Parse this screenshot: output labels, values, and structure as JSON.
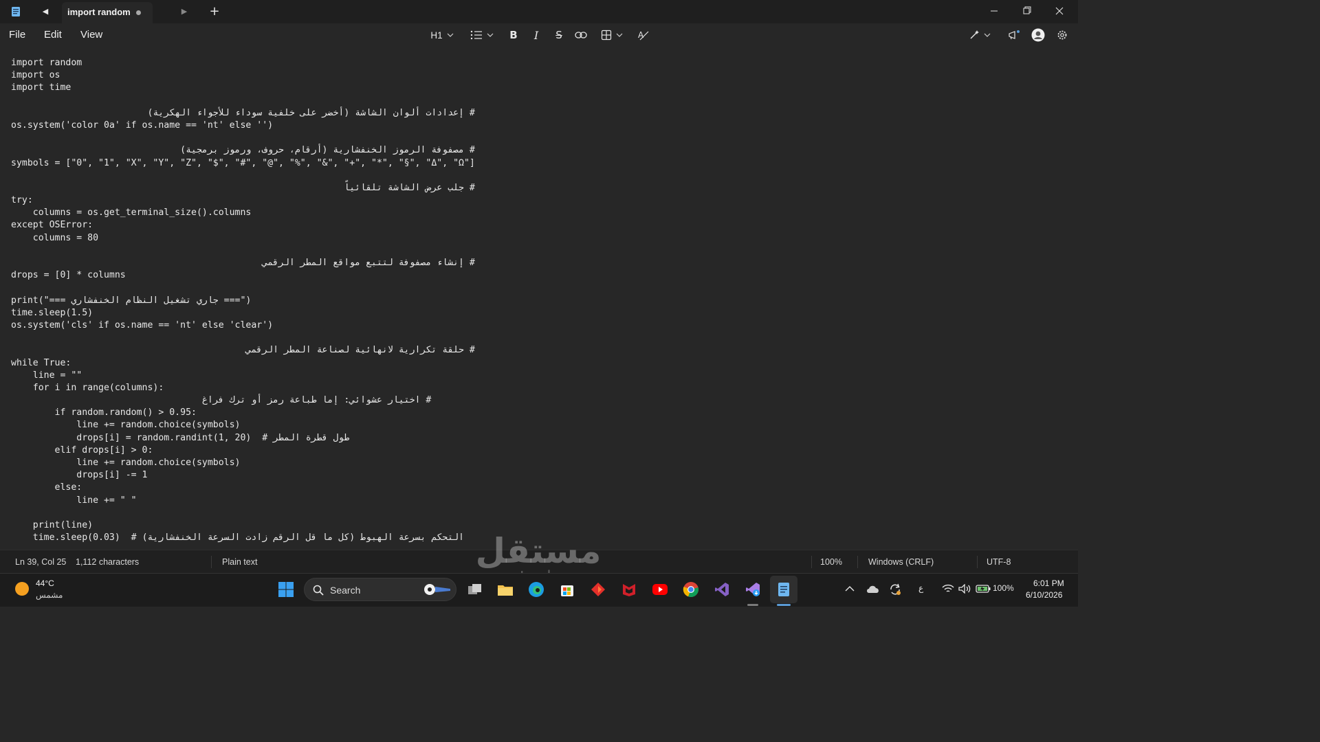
{
  "tab": {
    "title": "import random"
  },
  "menu": {
    "file": "File",
    "edit": "Edit",
    "view": "View"
  },
  "toolbar": {
    "heading": "H1"
  },
  "code_lines": [
    "import random",
    "import os",
    "import time",
    "",
    "# إعدادات ألوان الشاشة (أخضر على خلفية سوداء للأجواء الهكرية)",
    "os.system('color 0a' if os.name == 'nt' else '')",
    "",
    "# مصفوفة الرموز الخنفشارية (أرقام، حروف، ورموز برمجية)",
    "symbols = [\"0\", \"1\", \"X\", \"Y\", \"Z\", \"$\", \"#\", \"@\", \"%\", \"&\", \"+\", \"*\", \"§\", \"Δ\", \"Ω\"]",
    "",
    "# جلب عرض الشاشة تلقائياً",
    "try:",
    "    columns = os.get_terminal_size().columns",
    "except OSError:",
    "    columns = 80",
    "",
    "# إنشاء مصفوفة لتتبع مواقع المطر الرقمي",
    "drops = [0] * columns",
    "",
    "print(\"=== جاري تشغيل النظام الخنفشاري ===\")",
    "time.sleep(1.5)",
    "os.system('cls' if os.name == 'nt' else 'clear')",
    "",
    "# حلقة تكرارية لانهائية لصناعة المطر الرقمي",
    "while True:",
    "    line = \"\"",
    "    for i in range(columns):",
    "        # اختيار عشوائي: إما طباعة رمز أو ترك فراغ",
    "        if random.random() > 0.95:",
    "            line += random.choice(symbols)",
    "            drops[i] = random.randint(1, 20)  # طول قطرة المطر",
    "        elif drops[i] > 0:",
    "            line += random.choice(symbols)",
    "            drops[i] -= 1",
    "        else:",
    "            line += \" \"",
    "",
    "    print(line)",
    "    time.sleep(0.03)  # التحكم بسرعة الهبوط (كل ما قل الرقم زادت السرعة الخنفشارية)"
  ],
  "status": {
    "position": "Ln 39, Col 25",
    "characters": "1,112 characters",
    "format": "Plain text",
    "zoom": "100%",
    "line_ending": "Windows (CRLF)",
    "encoding": "UTF-8"
  },
  "watermark": {
    "arabic": "مستقل",
    "latin": "mostaql.com"
  },
  "taskbar": {
    "weather_temp": "44°C",
    "weather_cond": "مشمس",
    "search_label": "Search",
    "lang": "ع",
    "battery": "100%",
    "time": "6:01 PM",
    "date": "6/10/2026"
  },
  "icons": {
    "app": "notepad-icon",
    "accent": "#5b9bd5"
  }
}
